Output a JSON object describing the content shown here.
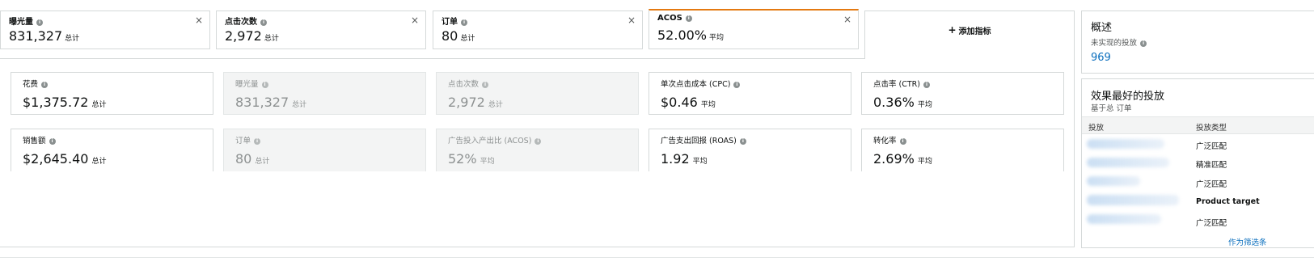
{
  "tiles": [
    {
      "label": "曝光量",
      "value": "831,327",
      "unit": "总计",
      "close": "×"
    },
    {
      "label": "点击次数",
      "value": "2,972",
      "unit": "总计",
      "close": "×"
    },
    {
      "label": "订单",
      "value": "80",
      "unit": "总计",
      "close": "×"
    },
    {
      "label": "ACOS",
      "value": "52.00%",
      "unit": "平均",
      "close": "×"
    }
  ],
  "add_metric": {
    "icon": "+",
    "label": "添加指标"
  },
  "cards_row1": [
    {
      "label": "花费",
      "value": "$1,375.72",
      "unit": "总计"
    },
    {
      "label": "曝光量",
      "value": "831,327",
      "unit": "总计"
    },
    {
      "label": "点击次数",
      "value": "2,972",
      "unit": "总计"
    },
    {
      "label": "单次点击成本 (CPC)",
      "value": "$0.46",
      "unit": "平均"
    },
    {
      "label": "点击率 (CTR)",
      "value": "0.36%",
      "unit": "平均"
    }
  ],
  "cards_row2": [
    {
      "label": "销售额",
      "value": "$2,645.40",
      "unit": "总计"
    },
    {
      "label": "订单",
      "value": "80",
      "unit": "总计"
    },
    {
      "label": "广告投入产出比 (ACOS)",
      "value": "52%",
      "unit": "平均"
    },
    {
      "label": "广告支出回报 (ROAS)",
      "value": "1.92",
      "unit": "平均"
    },
    {
      "label": "转化率",
      "value": "2.69%",
      "unit": "平均"
    }
  ],
  "overview": {
    "title": "概述",
    "subtitle": "未实现的投放",
    "value": "969"
  },
  "best": {
    "title": "效果最好的投放",
    "subtitle": "基于总 订单",
    "col_target": "投放",
    "col_type": "投放类型",
    "rows": [
      "广泛匹配",
      "精准匹配",
      "广泛匹配",
      "Product target",
      "广泛匹配"
    ],
    "filter_link": "作为筛选条"
  },
  "info_glyph": "i"
}
